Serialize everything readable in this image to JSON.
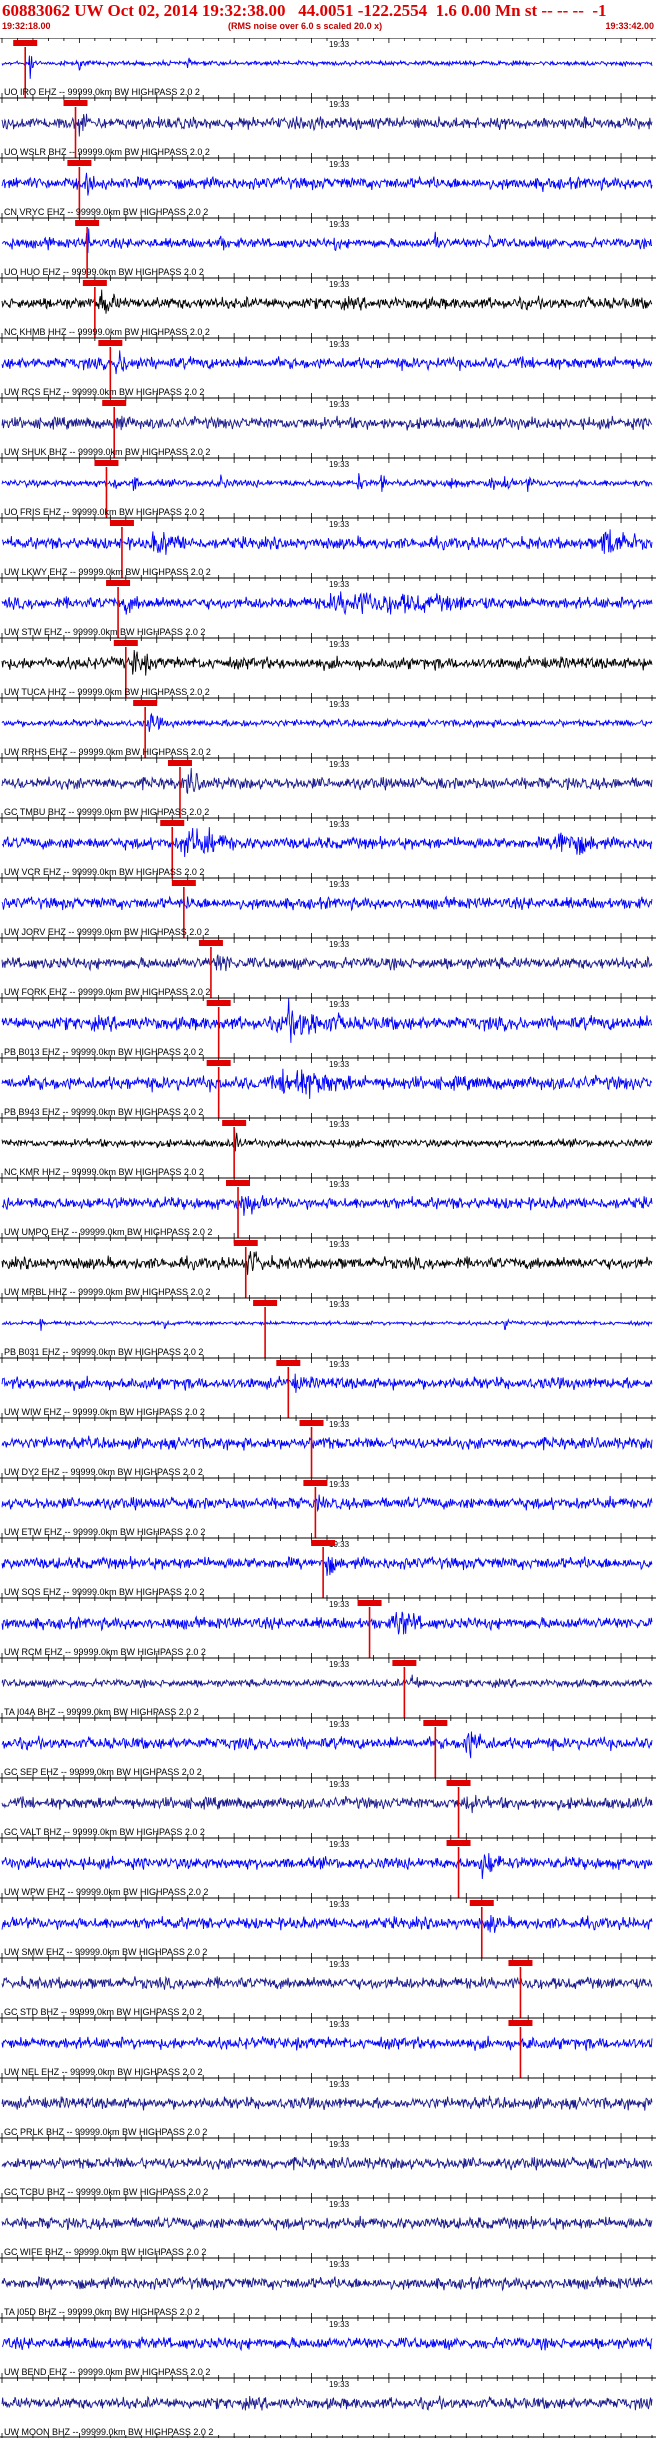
{
  "header": {
    "title": "60883062 UW Oct 02, 2014 19:32:38.00   44.0051 -122.2554  1.6 0.00 Mn st -- -- --  -1",
    "start_time": "19:32:18.00",
    "subtitle": "(RMS noise over 6.0 s scaled 20.0 x)",
    "end_time": "19:33:42.00"
  },
  "colors": {
    "header": "#e00000",
    "trace_blue": "#0000ff",
    "trace_navy": "#1a1a8c",
    "trace_black": "#000000",
    "pick": "#e00000"
  },
  "chart_data": {
    "type": "line",
    "title": "60883062 UW Oct 02, 2014 19:32:38.00   44.0051 -122.2554  1.6 0.00 Mn st -- -- --  -1",
    "time_start": "19:32:18.00",
    "time_end": "19:33:42.00",
    "duration_s": 84,
    "mid_tick_label": "19:33",
    "mid_tick_s": 42,
    "station_filter_text": "99999.0km BW  HIGHPASS  2.0  2",
    "traces": [
      {
        "label": "UO IRO EHZ",
        "color": "blue",
        "amp": 0.12,
        "pick_s": 3.0,
        "bursts": [
          [
            3.5,
            1.0,
            0.5
          ],
          [
            10,
            0.5,
            0.4
          ],
          [
            24,
            0.4,
            0.3
          ]
        ]
      },
      {
        "label": "UO WSLR BHZ",
        "color": "navy",
        "amp": 0.3,
        "pick_s": 9.5,
        "bursts": [
          [
            10,
            0.8,
            2.0
          ],
          [
            40,
            0.4,
            6
          ]
        ]
      },
      {
        "label": "CN VRYC EHZ",
        "color": "blue",
        "amp": 0.3,
        "pick_s": 10.0,
        "bursts": [
          [
            11,
            0.6,
            2.0
          ],
          [
            70,
            0.4,
            5
          ]
        ]
      },
      {
        "label": "UO HUO EHZ",
        "color": "blue",
        "amp": 0.25,
        "pick_s": 11.0,
        "bursts": [
          [
            1,
            0.7,
            0.5
          ],
          [
            6,
            0.6,
            0.5
          ],
          [
            11,
            1.0,
            0.7
          ],
          [
            28,
            0.8,
            0.8
          ],
          [
            43,
            0.6,
            0.6
          ],
          [
            56,
            0.9,
            0.8
          ],
          [
            63,
            0.8,
            0.8
          ],
          [
            69,
            0.6,
            0.5
          ]
        ]
      },
      {
        "label": "NC KHMB HHZ",
        "color": "black",
        "amp": 0.3,
        "pick_s": 12.0,
        "bursts": [
          [
            13,
            0.9,
            2.0
          ]
        ]
      },
      {
        "label": "UW RCS EHZ",
        "color": "blue",
        "amp": 0.3,
        "pick_s": 14.0,
        "bursts": [
          [
            15,
            0.8,
            3.0
          ]
        ]
      },
      {
        "label": "UW SHUK BHZ",
        "color": "navy",
        "amp": 0.3,
        "pick_s": 14.5,
        "bursts": [
          [
            15,
            0.7,
            2.0
          ]
        ]
      },
      {
        "label": "UO FRIS EHZ",
        "color": "blue",
        "amp": 0.18,
        "pick_s": 13.5,
        "bursts": [
          [
            14.5,
            0.8,
            0.6
          ],
          [
            17,
            0.7,
            0.6
          ],
          [
            28,
            0.9,
            0.8
          ],
          [
            46,
            0.7,
            0.6
          ],
          [
            49,
            0.8,
            0.6
          ],
          [
            58,
            0.9,
            0.6
          ],
          [
            63,
            0.8,
            0.6
          ],
          [
            65,
            0.9,
            0.6
          ],
          [
            68,
            0.8,
            0.5
          ]
        ]
      },
      {
        "label": "UW LKWY EHZ",
        "color": "blue",
        "amp": 0.3,
        "pick_s": 15.5,
        "bursts": [
          [
            20,
            0.8,
            5.0
          ],
          [
            78,
            1.0,
            4.0
          ]
        ]
      },
      {
        "label": "UW STW EHZ",
        "color": "blue",
        "amp": 0.3,
        "pick_s": 15.0,
        "bursts": [
          [
            16,
            0.6,
            3.0
          ],
          [
            45,
            0.7,
            25
          ]
        ]
      },
      {
        "label": "UW TUCA HHZ",
        "color": "black",
        "amp": 0.3,
        "pick_s": 16.0,
        "bursts": [
          [
            17,
            0.9,
            2.5
          ]
        ]
      },
      {
        "label": "UW RRHS EHZ",
        "color": "blue",
        "amp": 0.18,
        "pick_s": 18.5,
        "bursts": [
          [
            19,
            0.6,
            2.0
          ],
          [
            31,
            0.8,
            0.3
          ]
        ]
      },
      {
        "label": "GC TMBU BHZ",
        "color": "navy",
        "amp": 0.3,
        "pick_s": 23.0,
        "bursts": [
          [
            24,
            0.9,
            2.0
          ]
        ]
      },
      {
        "label": "UW VCR EHZ",
        "color": "blue",
        "amp": 0.3,
        "pick_s": 22.0,
        "bursts": [
          [
            24,
            1.0,
            6.0
          ],
          [
            72,
            1.0,
            4.5
          ]
        ]
      },
      {
        "label": "UW JORV EHZ",
        "color": "blue",
        "amp": 0.3,
        "pick_s": 23.5,
        "bursts": [
          [
            24,
            0.5,
            2.5
          ]
        ]
      },
      {
        "label": "UW FORK EHZ",
        "color": "navy",
        "amp": 0.3,
        "pick_s": 27.0,
        "bursts": [
          [
            28,
            0.7,
            3.0
          ]
        ]
      },
      {
        "label": "PB B013 EHZ",
        "color": "blue",
        "amp": 0.35,
        "pick_s": 28.0,
        "bursts": [
          [
            37,
            1.0,
            8.0
          ]
        ]
      },
      {
        "label": "PB B943 EHZ",
        "color": "blue",
        "amp": 0.35,
        "pick_s": 28.0,
        "bursts": [
          [
            37,
            1.0,
            8.0
          ]
        ]
      },
      {
        "label": "NC KMR HHZ",
        "color": "black",
        "amp": 0.2,
        "pick_s": 30.0,
        "bursts": [
          [
            30,
            1.0,
            0.6
          ]
        ]
      },
      {
        "label": "UW UMPQ EHZ",
        "color": "blue",
        "amp": 0.3,
        "pick_s": 30.5,
        "bursts": [
          [
            31,
            0.7,
            4.0
          ]
        ]
      },
      {
        "label": "UW MRBL HHZ",
        "color": "black",
        "amp": 0.3,
        "pick_s": 31.5,
        "bursts": [
          [
            32,
            0.8,
            3.0
          ]
        ]
      },
      {
        "label": "PB B031 EHZ",
        "color": "blue",
        "amp": 0.1,
        "pick_s": 34.0,
        "bursts": [
          [
            5,
            0.6,
            0.3
          ],
          [
            21,
            0.5,
            0.3
          ],
          [
            65,
            0.9,
            0.3
          ]
        ]
      },
      {
        "label": "UW WIW EHZ",
        "color": "blue",
        "amp": 0.3,
        "pick_s": 37.0,
        "bursts": [
          [
            38,
            0.6,
            2.0
          ]
        ]
      },
      {
        "label": "UW DY2 EHZ",
        "color": "blue",
        "amp": 0.3,
        "pick_s": 40.0,
        "bursts": [
          [
            41,
            0.6,
            2.0
          ]
        ]
      },
      {
        "label": "UW ETW EHZ",
        "color": "blue",
        "amp": 0.3,
        "pick_s": 40.5,
        "bursts": [
          [
            41,
            0.5,
            2.0
          ]
        ]
      },
      {
        "label": "UW SOS EHZ",
        "color": "blue",
        "amp": 0.3,
        "pick_s": 41.5,
        "bursts": [
          [
            42,
            0.7,
            2.0
          ]
        ]
      },
      {
        "label": "UW RCM EHZ",
        "color": "blue",
        "amp": 0.3,
        "pick_s": 47.5,
        "bursts": [
          [
            51,
            1.0,
            3.0
          ]
        ]
      },
      {
        "label": "TA I04A BHZ",
        "color": "navy",
        "amp": 0.2,
        "pick_s": 52.0,
        "bursts": [
          [
            53,
            0.6,
            1.5
          ]
        ]
      },
      {
        "label": "GC SEP EHZ",
        "color": "blue",
        "amp": 0.3,
        "pick_s": 56.0,
        "bursts": [
          [
            60,
            1.0,
            3.0
          ]
        ]
      },
      {
        "label": "GC VALT BHZ",
        "color": "navy",
        "amp": 0.3,
        "pick_s": 59.0,
        "bursts": [
          [
            60,
            0.7,
            2.0
          ]
        ]
      },
      {
        "label": "UW WPW EHZ",
        "color": "blue",
        "amp": 0.3,
        "pick_s": 59.0,
        "bursts": [
          [
            62,
            0.9,
            3.0
          ]
        ]
      },
      {
        "label": "UW SMW EHZ",
        "color": "blue",
        "amp": 0.3,
        "pick_s": 62.0,
        "bursts": [
          [
            63,
            0.6,
            2.5
          ],
          [
            22,
            0.5,
            1.0
          ]
        ]
      },
      {
        "label": "GC STD BHZ",
        "color": "navy",
        "amp": 0.3,
        "pick_s": 67.0,
        "bursts": [
          [
            68,
            0.5,
            2.0
          ]
        ]
      },
      {
        "label": "UW NEL EHZ",
        "color": "blue",
        "amp": 0.3,
        "pick_s": 67.0,
        "bursts": [
          [
            68,
            0.5,
            2.0
          ]
        ]
      },
      {
        "label": "GC PRLK BHZ",
        "color": "navy",
        "amp": 0.3,
        "pick_s": null,
        "bursts": []
      },
      {
        "label": "GC TCBU BHZ",
        "color": "navy",
        "amp": 0.3,
        "pick_s": null,
        "bursts": []
      },
      {
        "label": "GC WIFE BHZ",
        "color": "navy",
        "amp": 0.3,
        "pick_s": null,
        "bursts": []
      },
      {
        "label": "TA I05D BHZ",
        "color": "navy",
        "amp": 0.3,
        "pick_s": null,
        "bursts": []
      },
      {
        "label": "UW BEND EHZ",
        "color": "blue",
        "amp": 0.3,
        "pick_s": null,
        "bursts": []
      },
      {
        "label": "UW MOON BHZ",
        "color": "navy",
        "amp": 0.3,
        "pick_s": null,
        "bursts": []
      }
    ]
  }
}
